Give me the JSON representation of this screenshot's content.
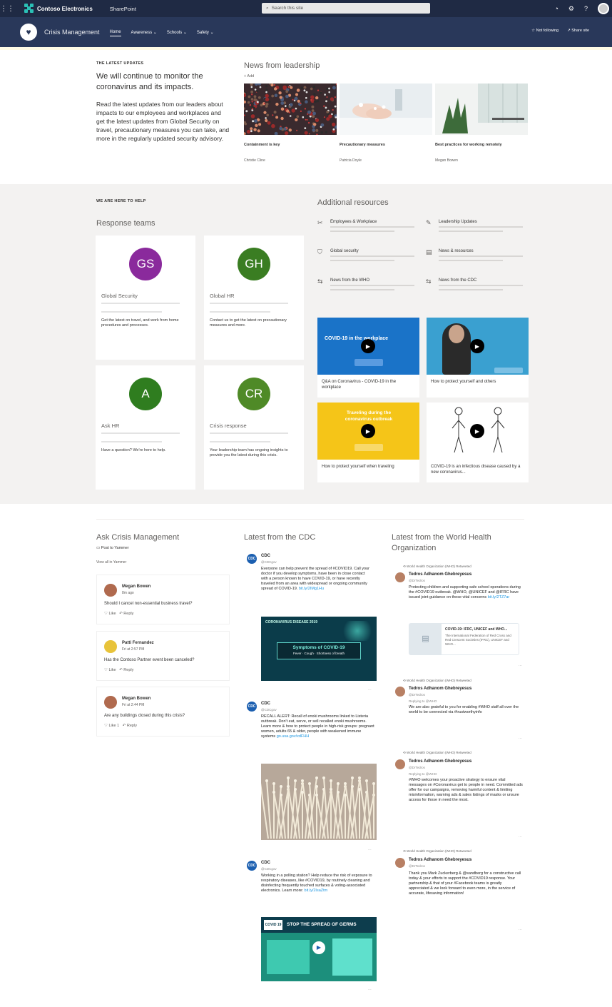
{
  "suitebar": {
    "org": "Contoso Electronics",
    "app": "SharePoint",
    "search_placeholder": "Search this site"
  },
  "site": {
    "name": "Crisis Management",
    "nav": [
      "Home",
      "Awareness",
      "Schools",
      "Safety"
    ],
    "follow": "Not following",
    "share": "Share site"
  },
  "latest": {
    "eyebrow": "THE LATEST UPDATES",
    "headline": "We will continue to monitor the coronavirus and its impacts.",
    "body": "Read the latest updates from our leaders about impacts to our employees and workplaces and get the latest updates from Global Security on travel, precautionary measures you can take, and more in the regularly updated security advisory."
  },
  "news": {
    "title": "News from leadership",
    "add": "+ Add",
    "items": [
      {
        "title": "Containment is key",
        "author": "Christie Cline"
      },
      {
        "title": "Precautionary measures",
        "author": "Patricia Doyle"
      },
      {
        "title": "Best practices for working remotely",
        "author": "Megan Bowen"
      }
    ]
  },
  "help": {
    "eyebrow": "WE ARE HERE TO HELP",
    "response_title": "Response teams"
  },
  "teams": [
    {
      "initials": "GS",
      "name": "Global Security",
      "desc": "Get the latest on travel, and work from home procedures and processes.",
      "color": "#8a2a9c"
    },
    {
      "initials": "GH",
      "name": "Global HR",
      "desc": "Contact us to get the latest on precautionary measures and more.",
      "color": "#3a7d22"
    },
    {
      "initials": "A",
      "name": "Ask HR",
      "desc": "Have a question? We're here to help.",
      "color": "#2f7d1f"
    },
    {
      "initials": "CR",
      "name": "Crisis response",
      "desc": "Your leadership team has ongoing insights to provide you the latest during this crisis.",
      "color": "#4f8a27"
    }
  ],
  "resources": {
    "title": "Additional resources",
    "items": [
      {
        "label": "Employees & Workplace",
        "icon": "✂"
      },
      {
        "label": "Leadership Updates",
        "icon": "✎"
      },
      {
        "label": "Global security",
        "icon": "⛉"
      },
      {
        "label": "News & resources",
        "icon": "▤"
      },
      {
        "label": "News from the WHO",
        "icon": "⇆"
      },
      {
        "label": "News from the CDC",
        "icon": "⇆"
      }
    ]
  },
  "videos": [
    {
      "title": "Q&A on Coronavirus - COVID-19 in the workplace",
      "overlay": "COVID-19 in the workplace"
    },
    {
      "title": "How to protect yourself and others",
      "overlay": ""
    },
    {
      "title": "How to protect yourself when traveling",
      "overlay": "Traveling during the coronavirus outbreak"
    },
    {
      "title": "COVID-19 is an infectious disease caused by a new coronavirus...",
      "overlay": ""
    }
  ],
  "ask": {
    "title": "Ask Crisis Management",
    "post_label": "Post to Yammer",
    "view_all": "View all in Yammer",
    "posts": [
      {
        "name": "Megan Bowen",
        "time": "8m ago",
        "question": "Should I cancel non-essential business travel?",
        "likes": "Like",
        "reply": "Reply"
      },
      {
        "name": "Patti Fernandez",
        "time": "Fri at 2:57 PM",
        "question": "Has the Contoso Partner event been canceled?",
        "likes": "Like",
        "reply": "Reply"
      },
      {
        "name": "Megan Bowen",
        "time": "Fri at 2:44 PM",
        "question": "Are any buildings closed during this crisis?",
        "likes": "Like 1",
        "reply": "Reply"
      }
    ]
  },
  "cdc": {
    "title": "Latest from the CDC",
    "tweets": [
      {
        "handle": "CDC",
        "sub": "@CDCgov",
        "text": "Everyone can help prevent the spread of #COVID19. Call your doctor if you develop symptoms, have been in close contact with a person known to have COVID-19, or have recently traveled from an area with widespread or ongoing community spread of COVID-19.",
        "link": "bit.ly/2IMg1Hu",
        "card_title": "CORONAVIRUS DISEASE 2019",
        "card_sub": "Symptoms of COVID-19",
        "card_sub2": "Fever · Cough · Shortness of breath"
      },
      {
        "handle": "CDC",
        "sub": "@CDCgov",
        "text": "RECALL ALERT: Recall of enoki mushrooms linked to Listeria outbreak. Don't eat, serve, or sell recalled enoki mushrooms. Learn more & how to protect people in high-risk groups: pregnant women, adults 65 & older, people with weakened immune systems",
        "link": "go.usa.gov/xdFHH"
      },
      {
        "handle": "CDC",
        "sub": "@CDCgov",
        "text": "Working in a polling station? Help reduce the risk of exposure to respiratory diseases, like #COVID19, by routinely cleaning and disinfecting frequently touched surfaces & voting-associated electronics. Learn more:",
        "link": "bit.ly/2IsaZtm",
        "card_title": "STOP THE SPREAD OF GERMS"
      }
    ]
  },
  "who": {
    "title": "Latest from the World Health Organization",
    "retweet": "World Health Organization (WHO) Retweeted",
    "tweets": [
      {
        "handle": "Tedros Adhanom Ghebreyesus",
        "sub": "@DrTedros",
        "text": "Protecting children and supporting safe school operations during the #COVID19 outbreak. @WHO, @UNICEF and @IFRC have issued joint guidance on these vital concerns",
        "link": "bit.ly/2TZ7ar",
        "card_title": "COVID-19: IFRC, UNICEF and WHO...",
        "card_text": "The International Federation of Red Cross and Red Crescent Societies (IFRC), UNICEF and WHO..."
      },
      {
        "handle": "Tedros Adhanom Ghebreyesus",
        "sub": "@DrTedros",
        "reply": "Replying to @WHO",
        "text": "We are also grateful to you for enabling #WHO staff all over the world to be connected via #trustworthyinfo"
      },
      {
        "handle": "Tedros Adhanom Ghebreyesus",
        "sub": "@DrTedros",
        "reply": "Replying to @WHO",
        "text": "#WHO welcomes your proactive strategy to ensure vital messages on #Coronavirus get to people in need. Committed ads offer for our campaigns, removing harmful content & limiting misinformation, warning ads & sales listings of masks or unsure access for those in need the most."
      },
      {
        "handle": "Tedros Adhanom Ghebreyesus",
        "sub": "@DrTedros",
        "text": "Thank you Mark Zuckerberg & @sandberg for a constructive call today & your efforts to support the #COVID19 response. Your partnership & that of your #Facebook teams is greatly appreciated & we look forward to even more, in the service of accurate, lifesaving information!"
      }
    ]
  },
  "colors": {
    "suitebar": "#1f2a44",
    "sitebar": "#29385a",
    "accent": "#2bc0b6",
    "twitter_blue": "#1b95e0"
  }
}
